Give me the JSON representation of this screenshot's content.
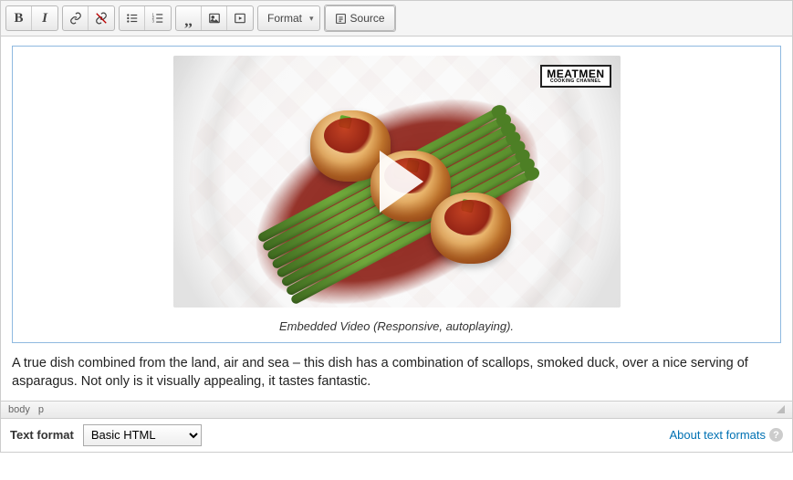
{
  "toolbar": {
    "format_label": "Format",
    "source_label": "Source"
  },
  "embed": {
    "watermark_line1": "MEATMEN",
    "watermark_line2": "COOKING CHANNEL",
    "caption": "Embedded Video (Responsive, autoplaying)."
  },
  "body_paragraph": "A true dish combined from the land, air and sea – this dish has a combination of scallops, smoked duck, over a nice serving of asparagus. Not only is it visually appealing, it tastes fantastic.",
  "path": {
    "tag1": "body",
    "tag2": "p"
  },
  "footer": {
    "label": "Text format",
    "option": "Basic HTML",
    "about": "About text formats"
  }
}
